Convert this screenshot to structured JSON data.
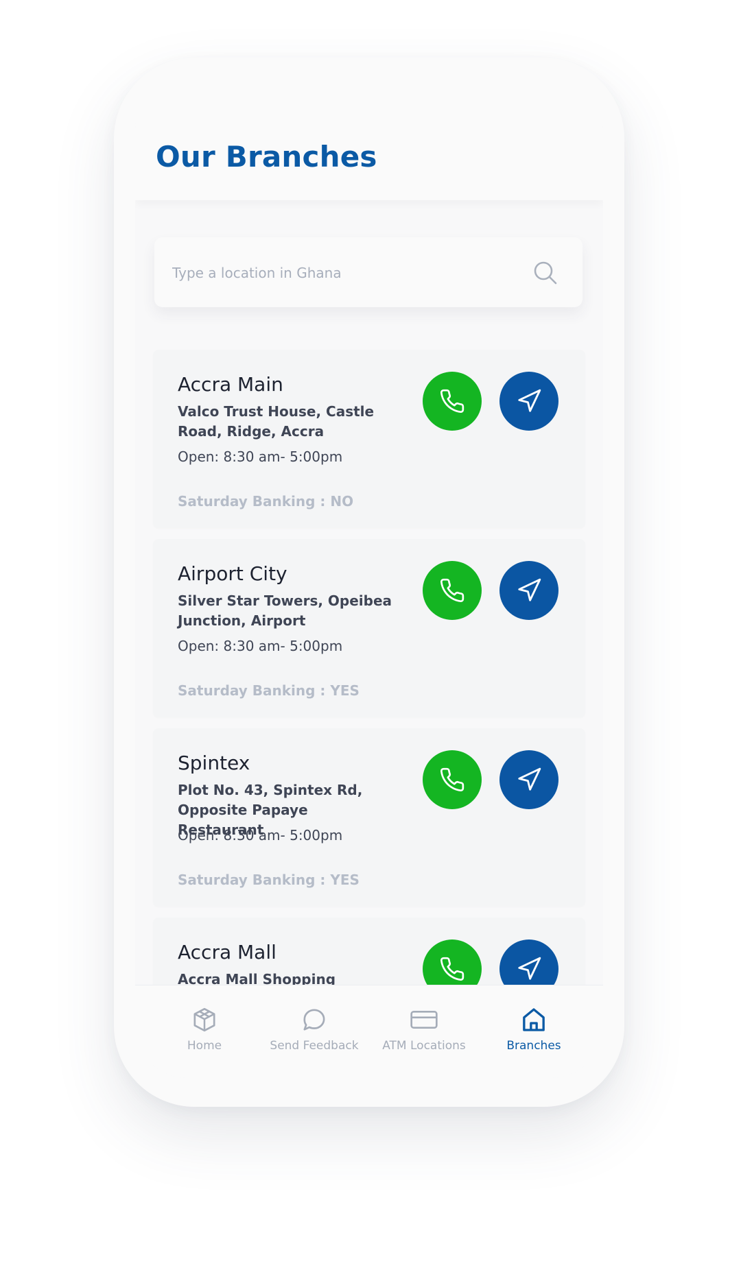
{
  "header": {
    "title": "Our Branches"
  },
  "search": {
    "placeholder": "Type a location in Ghana",
    "value": ""
  },
  "branches": [
    {
      "name": "Accra Main",
      "address": "Valco Trust House, Castle Road, Ridge, Accra",
      "hours": "Open: 8:30 am- 5:00pm",
      "saturday": "Saturday Banking : NO"
    },
    {
      "name": "Airport City",
      "address": "Silver Star Towers, Opeibea Junction, Airport",
      "hours": "Open: 8:30 am- 5:00pm",
      "saturday": "Saturday Banking : YES"
    },
    {
      "name": "Spintex",
      "address": "Plot No. 43, Spintex Rd, Opposite Papaye Restaurant",
      "hours": "Open: 8:30 am- 5:00pm",
      "saturday": "Saturday Banking : YES"
    },
    {
      "name": "Accra Mall",
      "address": "Accra Mall Shopping Arcade,",
      "hours": "",
      "saturday": ""
    }
  ],
  "icons": {
    "call": "phone-icon",
    "directions": "navigation-arrow-icon",
    "search": "search-icon"
  },
  "tabbar": {
    "items": [
      {
        "label": "Home",
        "icon": "cube-icon",
        "active": false
      },
      {
        "label": "Send Feedback",
        "icon": "chat-bubble-icon",
        "active": false
      },
      {
        "label": "ATM Locations",
        "icon": "card-icon",
        "active": false
      },
      {
        "label": "Branches",
        "icon": "house-icon",
        "active": true
      }
    ]
  },
  "colors": {
    "brand_blue": "#0b5aa5",
    "call_green": "#14b522",
    "directions_blue": "#0b56a3",
    "muted_text": "#b5bcc8"
  }
}
